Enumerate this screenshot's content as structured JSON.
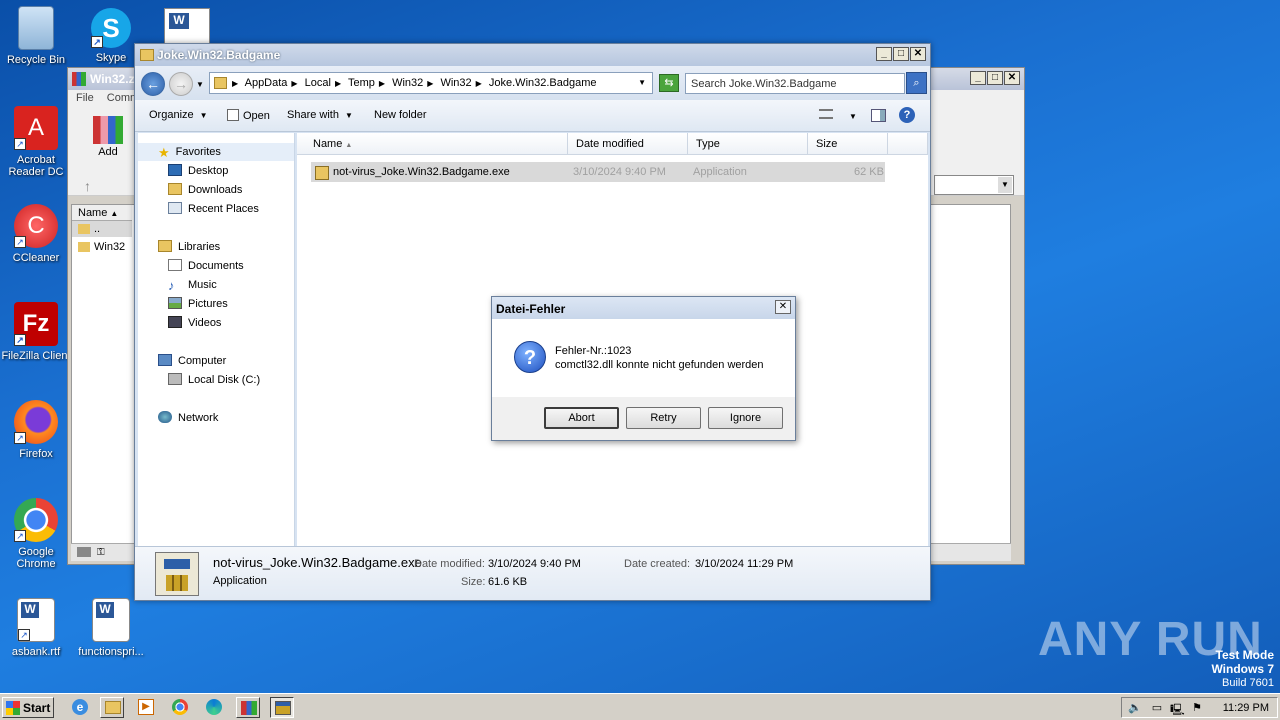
{
  "desktop": {
    "icons": [
      {
        "label": "Recycle Bin"
      },
      {
        "label": "Skype"
      },
      {
        "label": "Acrobat Reader DC"
      },
      {
        "label": "CCleaner"
      },
      {
        "label": "FileZilla Client"
      },
      {
        "label": "Firefox"
      },
      {
        "label": "Google Chrome"
      },
      {
        "label": "asbank.rtf"
      },
      {
        "label": "functionspri..."
      }
    ],
    "watermark": "ANY RUN",
    "test_mode": {
      "line1": "Test Mode",
      "line2": "Windows 7",
      "line3": "Build 7601"
    }
  },
  "winrar": {
    "title": "Win32.z",
    "menu": {
      "file": "File",
      "commands": "Comm"
    },
    "add_label": "Add",
    "list_header_name": "Name",
    "rows": [
      {
        "name": ".."
      },
      {
        "name": "Win32"
      }
    ]
  },
  "explorer": {
    "title": "Joke.Win32.Badgame",
    "address": [
      "AppData",
      "Local",
      "Temp",
      "Win32",
      "Win32",
      "Joke.Win32.Badgame"
    ],
    "search_placeholder": "Search Joke.Win32.Badgame",
    "commands": {
      "organize": "Organize",
      "open": "Open",
      "share_with": "Share with",
      "new_folder": "New folder"
    },
    "nav": {
      "favorites": "Favorites",
      "desktop": "Desktop",
      "downloads": "Downloads",
      "recent_places": "Recent Places",
      "libraries": "Libraries",
      "documents": "Documents",
      "music": "Music",
      "pictures": "Pictures",
      "videos": "Videos",
      "computer": "Computer",
      "local_disk": "Local Disk (C:)",
      "network": "Network"
    },
    "columns": {
      "name": "Name",
      "date_modified": "Date modified",
      "type": "Type",
      "size": "Size"
    },
    "files": [
      {
        "name": "not-virus_Joke.Win32.Badgame.exe",
        "date_modified": "3/10/2024 9:40 PM",
        "type": "Application",
        "size": "62 KB"
      }
    ],
    "details": {
      "filename": "not-virus_Joke.Win32.Badgame.exe",
      "type": "Application",
      "date_modified_label": "Date modified:",
      "date_modified": "3/10/2024 9:40 PM",
      "size_label": "Size:",
      "size": "61.6 KB",
      "date_created_label": "Date created:",
      "date_created": "3/10/2024 11:29 PM"
    }
  },
  "dialog": {
    "title": "Datei-Fehler",
    "line1": "Fehler-Nr.:1023",
    "line2": "comctl32.dll konnte nicht gefunden werden",
    "buttons": {
      "abort": "Abort",
      "retry": "Retry",
      "ignore": "Ignore"
    }
  },
  "taskbar": {
    "start": "Start",
    "clock": "11:29 PM"
  }
}
